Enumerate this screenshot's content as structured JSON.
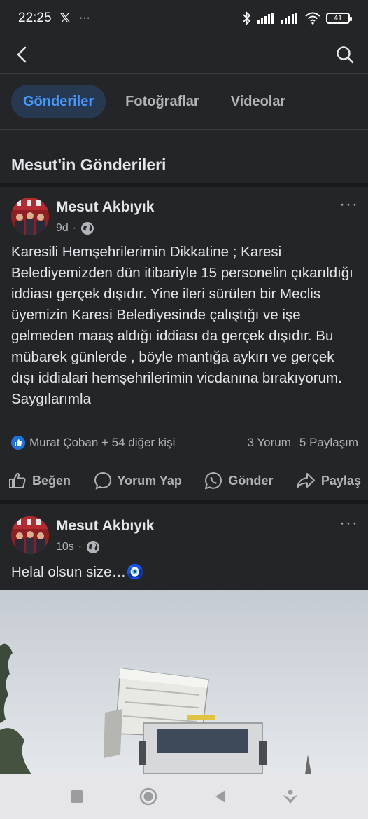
{
  "status_bar": {
    "time": "22:25",
    "x_logo": "𝕏",
    "overflow": "···",
    "battery": "41"
  },
  "tabs": [
    {
      "label": "Gönderiler",
      "active": true
    },
    {
      "label": "Fotoğraflar",
      "active": false
    },
    {
      "label": "Videolar",
      "active": false
    }
  ],
  "section_title": "Mesut'in Gönderileri",
  "posts": [
    {
      "author": "Mesut Akbıyık",
      "time": "9d",
      "dot": "·",
      "more": "···",
      "text": "Karesili Hemşehrilerimin Dikkatine ; Karesi Belediyemizden dün itibariyle 15 personelin çıkarıldığı iddiası gerçek dışıdır. Yine ileri sürülen bir Meclis üyemizin Karesi Belediyesinde çalıştığı ve işe gelmeden maaş aldığı iddiası da gerçek dışıdır. Bu mübarek günlerde , böyle mantığa aykırı ve gerçek dışı iddialari hemşehrilerimin vicdanına bırakıyorum. Saygılarımla",
      "reactions": "Murat Çoban + 54 diğer kişi",
      "comments": "3 Yorum",
      "shares": "5 Paylaşım"
    },
    {
      "author": "Mesut Akbıyık",
      "time": "10s",
      "dot": "·",
      "more": "···",
      "text": "Helal olsun size…🧿"
    }
  ],
  "actions": {
    "like": "Beğen",
    "comment": "Yorum Yap",
    "send": "Gönder",
    "share": "Paylaş"
  },
  "colors": {
    "background": "#242526",
    "accent": "#4599ff",
    "tab_active_bg": "#263951",
    "muted_text": "#b0b3b8",
    "like_blue": "#1b74e4"
  }
}
